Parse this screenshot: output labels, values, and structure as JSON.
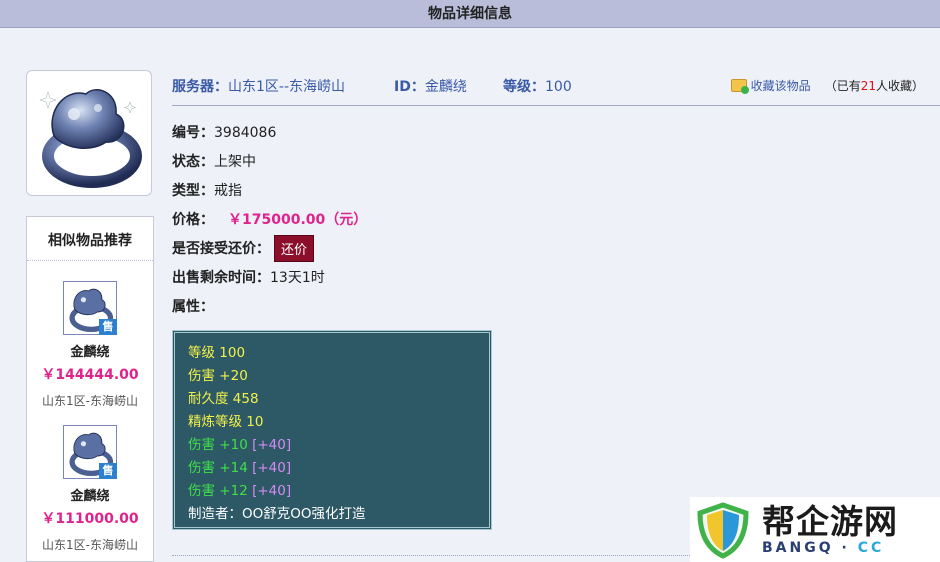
{
  "header": {
    "title": "物品详细信息"
  },
  "info_bar": {
    "server_label": "服务器：",
    "server_value": "山东1区--东海崂山",
    "id_label": "ID：",
    "id_value": "金麟绕",
    "level_label": "等级：",
    "level_value": "100",
    "favorite_link": "收藏该物品",
    "favorite_prefix": "（已有",
    "favorite_count": "21",
    "favorite_suffix": "人收藏）"
  },
  "fields": {
    "number_label": "编号：",
    "number_value": "3984086",
    "status_label": "状态：",
    "status_value": "上架中",
    "type_label": "类型：",
    "type_value": "戒指",
    "price_label": "价格：",
    "price_value": "￥175000.00（元）",
    "counter_label": "是否接受还价：",
    "counter_button": "还价",
    "time_label": "出售剩余时间：",
    "time_value": "13天1时",
    "attr_label": "属性："
  },
  "attributes": {
    "a1": "等级 100",
    "a2": "伤害 +20",
    "a3": "耐久度 458",
    "a4": "精炼等级 10",
    "b1": "伤害 +10",
    "b1x": "[+40]",
    "b2": "伤害 +14",
    "b2x": "[+40]",
    "b3": "伤害 +12",
    "b3x": "[+40]",
    "maker": "制造者：OO舒克OO强化打造"
  },
  "similar": {
    "title": "相似物品推荐",
    "items": [
      {
        "badge": "售",
        "name": "金麟绕",
        "price": "￥144444.00",
        "server": "山东1区-东海崂山"
      },
      {
        "badge": "售",
        "name": "金麟绕",
        "price": "￥111000.00",
        "server": "山东1区-东海崂山"
      }
    ]
  },
  "watermark": {
    "big": "帮企游网",
    "small_a": "BANGQ",
    "small_dot": " · ",
    "small_b": "CC"
  },
  "colors": {
    "header_bg": "#b9bdd9",
    "price": "#e0238c",
    "link": "#3a5aa8",
    "attr_bg": "#2d5866",
    "button": "#8b0f2a"
  },
  "icons": [
    "ring-image",
    "folder-add-icon",
    "sale-badge",
    "shield-logo-icon"
  ]
}
